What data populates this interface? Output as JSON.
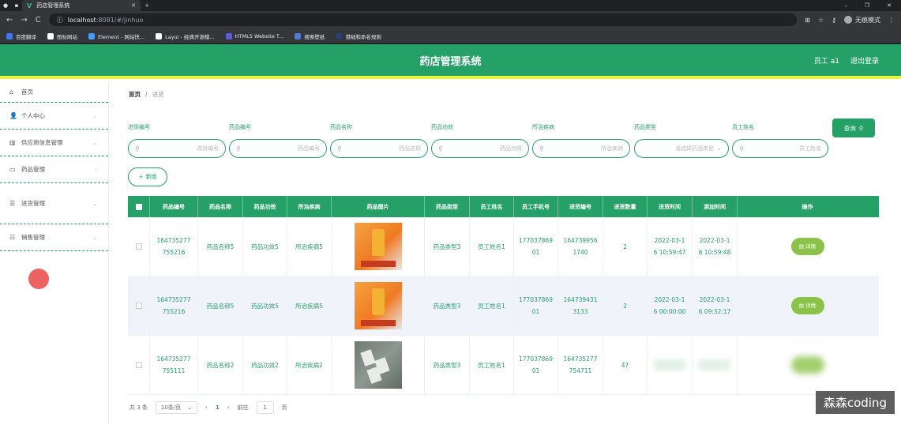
{
  "browser": {
    "tab_title": "药店管理系统",
    "url_host": "localhost",
    "url_path": ":8081/#/jinhuo",
    "incognito_label": "无痕模式",
    "bookmarks": [
      {
        "label": "百度翻译",
        "color": "#3b7bf0"
      },
      {
        "label": "图标网站",
        "color": "#ffffff"
      },
      {
        "label": "Element - 网站快...",
        "color": "#409eff"
      },
      {
        "label": "Layui - 经典开源模...",
        "color": "#ffffff"
      },
      {
        "label": "HTML5 Website T...",
        "color": "#5b5bd6"
      },
      {
        "label": "搜索壁纸",
        "color": "#4a7dd6"
      },
      {
        "label": "港础和命名规则",
        "color": "#2e3d7a"
      }
    ]
  },
  "header": {
    "title": "药店管理系统",
    "user": "员工 a1",
    "logout": "退出登录",
    "accent": "#25a067",
    "underline": "#e8f53f"
  },
  "sidebar": {
    "items": [
      {
        "label": "首页",
        "icon": "home-icon"
      },
      {
        "label": "个人中心",
        "icon": "user-icon"
      },
      {
        "label": "供应商信息管理",
        "icon": "chart-icon"
      },
      {
        "label": "药品管理",
        "icon": "monitor-icon"
      },
      {
        "label": "进货管理",
        "icon": "list-icon"
      },
      {
        "label": "销售管理",
        "icon": "sliders-icon"
      }
    ]
  },
  "breadcrumb": {
    "home": "首页",
    "separator": "/",
    "current": "进货"
  },
  "filters": [
    {
      "label": "进货编号",
      "placeholder": "进货编号"
    },
    {
      "label": "药品编号",
      "placeholder": "药品编号"
    },
    {
      "label": "药品名称",
      "placeholder": "药品名称"
    },
    {
      "label": "药品功效",
      "placeholder": "药品功效"
    },
    {
      "label": "所治疾病",
      "placeholder": "所治疾病"
    },
    {
      "label": "药品类型",
      "placeholder": "请选择药品类型"
    },
    {
      "label": "员工姓名",
      "placeholder": "员工姓名"
    }
  ],
  "search_button": "查询",
  "add_button": "新增",
  "table": {
    "headers": [
      "药品编号",
      "药品名称",
      "药品功效",
      "所治疾病",
      "药品图片",
      "药品类型",
      "员工姓名",
      "员工手机号",
      "进货编号",
      "进货数量",
      "进货时间",
      "添加时间",
      "操作"
    ],
    "rows": [
      {
        "code": "164735277\n755216",
        "name": "药品名称5",
        "effect": "药品功效5",
        "disease": "所治疾病5",
        "type": "药品类型3",
        "staff": "员工姓名1",
        "phone": "177037869\n01",
        "purchase_no": "164739956\n1740",
        "qty": "2",
        "purchase_time": "2022-03-1\n6 10:59:47",
        "add_time": "2022-03-1\n6 10:59:48",
        "action": "详情"
      },
      {
        "code": "164735277\n755216",
        "name": "药品名称5",
        "effect": "药品功效5",
        "disease": "所治疾病5",
        "type": "药品类型3",
        "staff": "员工姓名1",
        "phone": "177037869\n01",
        "purchase_no": "164739431\n3133",
        "qty": "2",
        "purchase_time": "2022-03-1\n6 00:00:00",
        "add_time": "2022-03-1\n6 09:32:17",
        "action": "详情"
      },
      {
        "code": "164735277\n755111",
        "name": "药品名称2",
        "effect": "药品功效2",
        "disease": "所治疾病2",
        "type": "药品类型3",
        "staff": "员工姓名1",
        "phone": "177037869\n01",
        "purchase_no": "164735277\n754711",
        "qty": "47",
        "purchase_time": "",
        "add_time": "",
        "action": ""
      }
    ]
  },
  "pagination": {
    "total": "共 3 条",
    "page_size": "10条/页",
    "current": "1",
    "goto_label": "前往",
    "goto_value": "1",
    "page_suffix": "页"
  },
  "watermark": "森森coding"
}
